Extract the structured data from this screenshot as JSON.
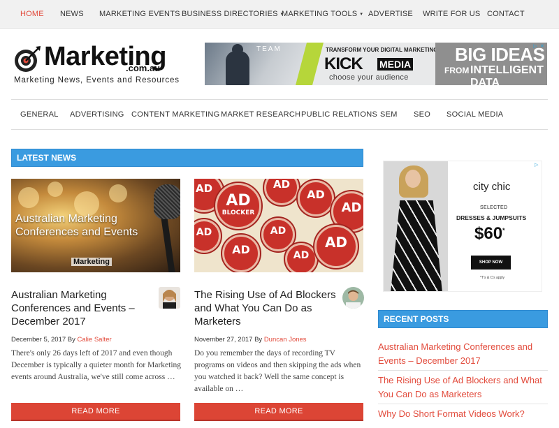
{
  "topnav": [
    {
      "label": "HOME",
      "active": true
    },
    {
      "label": "NEWS"
    },
    {
      "label": "MARKETING EVENTS"
    },
    {
      "label": "BUSINESS DIRECTORIES",
      "dropdown": "▾"
    },
    {
      "label": "MARKETING TOOLS",
      "dropdown": "▾"
    },
    {
      "label": "ADVERTISE"
    },
    {
      "label": "WRITE FOR US"
    },
    {
      "label": "CONTACT"
    }
  ],
  "logo": {
    "word": "Marketing",
    "domain": ".com.au",
    "tagline": "Marketing News, Events and Resources",
    "icon": "target-arrow-icon"
  },
  "banner": {
    "team": "TEAM",
    "transform": "TRANSFORM YOUR DIGITAL MARKETING @",
    "kick": "KICK",
    "media": "MEDIA",
    "choose": "choose your audience",
    "big": "BIG IDEAS",
    "from": "FROM",
    "intelligent": "INTELLIGENT DATA",
    "adchoices_icon": "ad-choices-icon"
  },
  "categories": [
    "GENERAL",
    "ADVERTISING",
    "CONTENT MARKETING",
    "MARKET RESEARCH",
    "PUBLIC RELATIONS",
    "SEM",
    "SEO",
    "SOCIAL MEDIA"
  ],
  "latest_news": {
    "heading": "LATEST NEWS",
    "articles": [
      {
        "image_text": "Australian Marketing Conferences and Events",
        "image_brand": "Marketing",
        "title": "Australian Marketing Conferences and Events – December 2017",
        "date_by": "December 5, 2017 By",
        "author": "Calie Salter",
        "excerpt": "There's only 26 days left of 2017 and even though December is typically a quieter month for Marketing events around Australia, we've still come across …",
        "read_more": "READ MORE"
      },
      {
        "image_badge_line1": "AD",
        "image_badge_line2": "BLOCKER",
        "title": "The Rising Use of Ad Blockers and What You Can Do as Marketers",
        "date_by": "November 27, 2017 By",
        "author": "Duncan Jones",
        "excerpt": "Do you remember the days of recording TV programs on videos and then skipping the ads when you watched it back? Well the same concept is available on …",
        "read_more": "READ MORE"
      }
    ]
  },
  "sidebar_ad": {
    "brand": "city chic",
    "selected": "SELECTED",
    "product": "DRESSES & JUMPSUITS",
    "price": "$60",
    "price_mark": "*",
    "cta": "SHOP NOW",
    "terms": "*T's & C's apply"
  },
  "recent_posts": {
    "heading": "RECENT POSTS",
    "items": [
      "Australian Marketing Conferences and Events – December 2017",
      "The Rising Use of Ad Blockers and What You Can Do as Marketers",
      "Why Do Short Format Videos Work?"
    ]
  },
  "colors": {
    "accent_red": "#e24a3b",
    "section_blue": "#3a9be0",
    "button_red": "#dc4535"
  }
}
